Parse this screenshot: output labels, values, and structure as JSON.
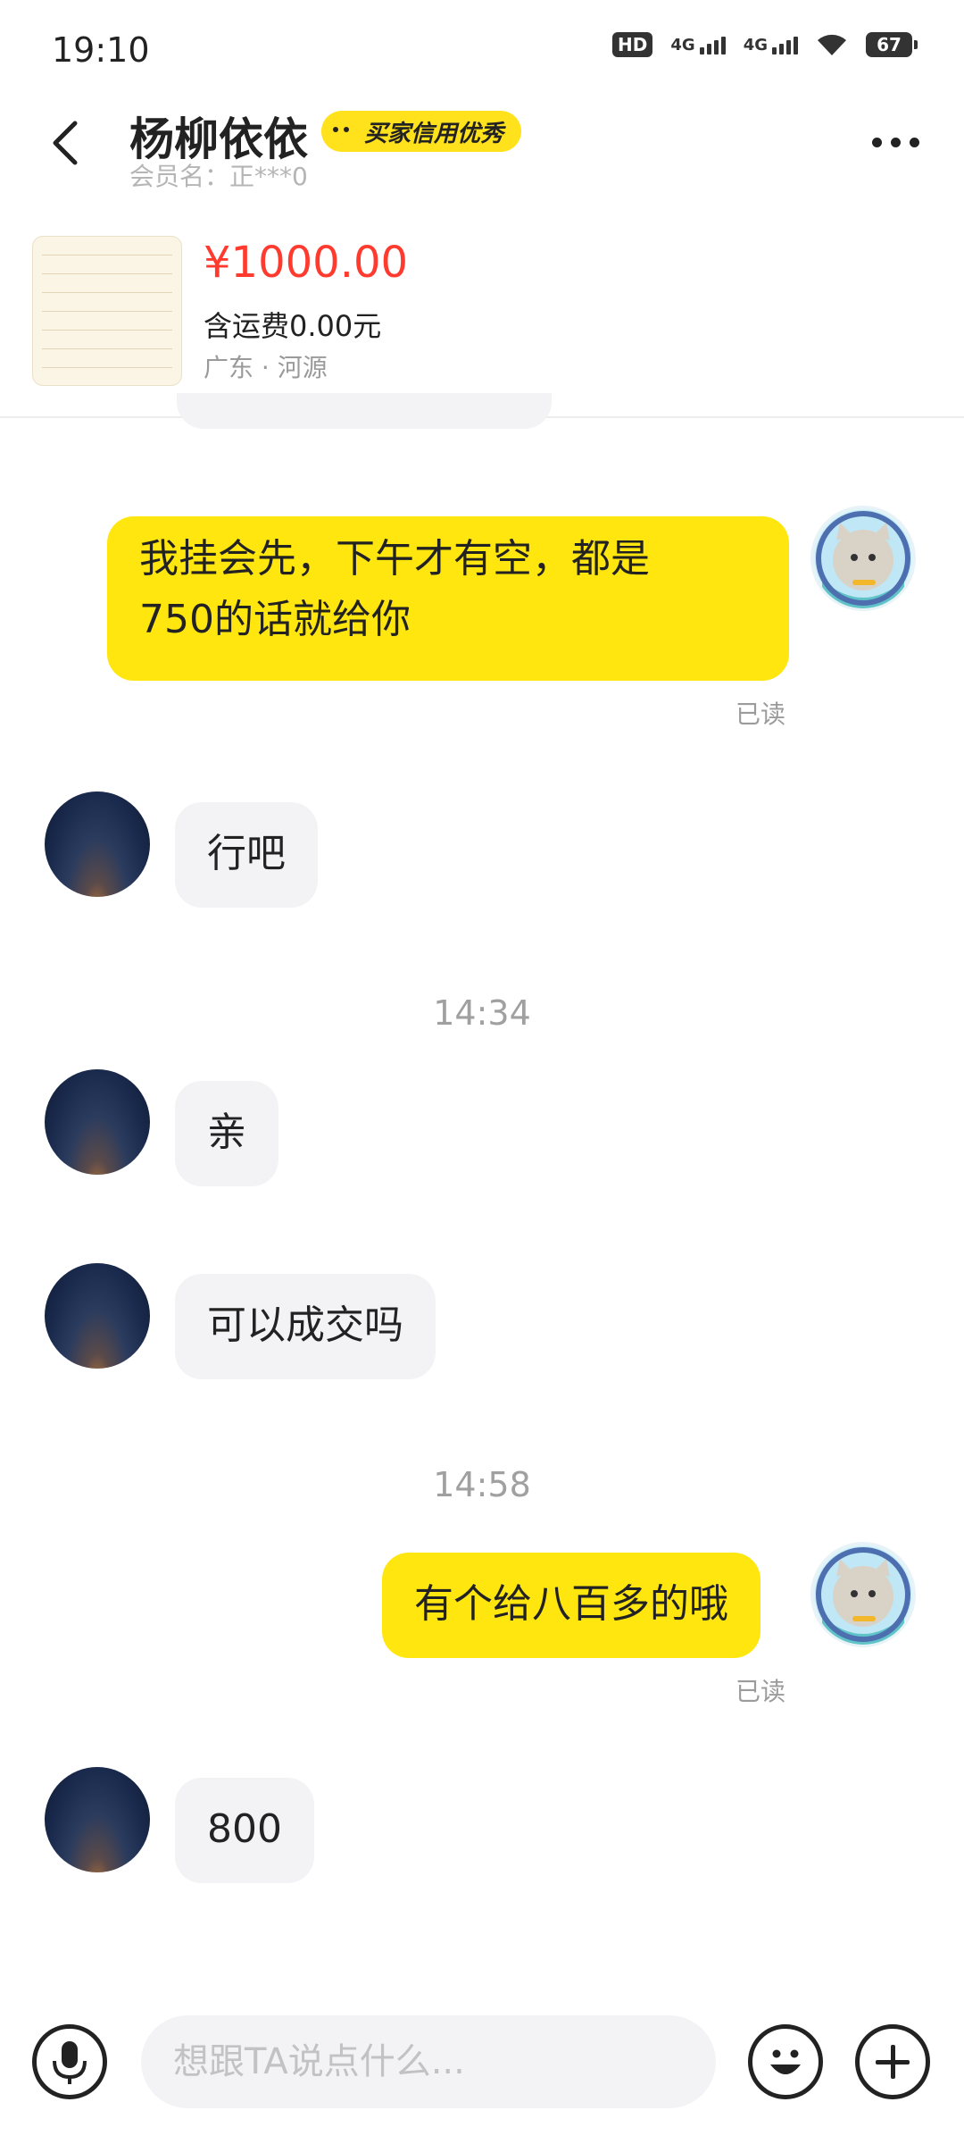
{
  "status_bar": {
    "time": "19:10",
    "hd_label": "HD",
    "network_1": "4G",
    "network_2": "4G",
    "battery": "67"
  },
  "header": {
    "name": "杨柳依依",
    "credit_badge": "买家信用优秀",
    "member": "会员名：正***0"
  },
  "product": {
    "price": "¥1000.00",
    "shipping": "含运费0.00元",
    "location": "广东 · 河源"
  },
  "messages": [
    {
      "side": "mine",
      "text_line1": "我挂会先，下午才有空，都是",
      "text_line2": "750的话就给你",
      "status": "已读"
    },
    {
      "side": "theirs",
      "text": "行吧"
    },
    {
      "type": "time",
      "text": "14:34"
    },
    {
      "side": "theirs",
      "text": "亲"
    },
    {
      "side": "theirs",
      "text": "可以成交吗"
    },
    {
      "type": "time",
      "text": "14:58"
    },
    {
      "side": "mine",
      "text": "有个给八百多的哦",
      "status": "已读"
    },
    {
      "side": "theirs",
      "text": "800"
    }
  ],
  "input": {
    "placeholder": "想跟TA说点什么..."
  },
  "icons": {
    "back": "back-arrow-icon",
    "more": "more-dots-icon",
    "mic": "microphone-icon",
    "emoji": "emoji-icon",
    "plus": "plus-icon"
  },
  "colors": {
    "accent_yellow": "#ffe60f",
    "price_red": "#ff3b30",
    "bubble_gray": "#f3f3f5"
  }
}
